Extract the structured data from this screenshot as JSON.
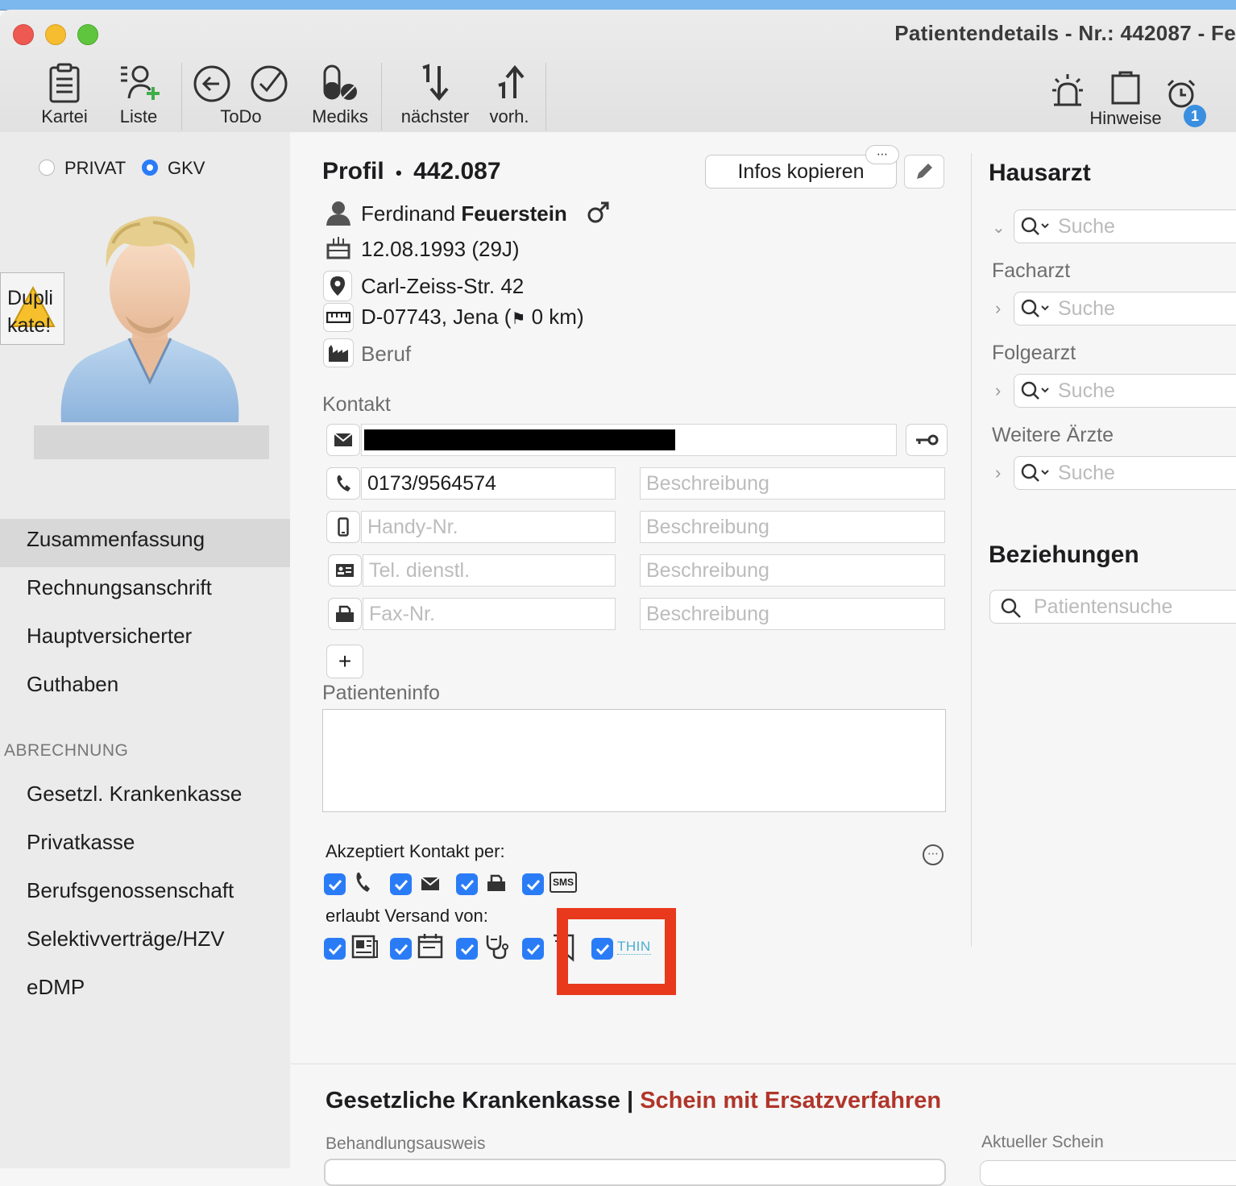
{
  "window": {
    "title": "Patientendetails - Nr.: 442087 - Fe"
  },
  "toolbar": {
    "kartei": "Kartei",
    "liste": "Liste",
    "todo": "ToDo",
    "mediks": "Mediks",
    "naechster": "nächster",
    "vorh": "vorh.",
    "hinweise": "Hinweise",
    "alarm_badge": "1"
  },
  "insurance": {
    "privat": "PRIVAT",
    "gkv": "GKV",
    "selected": "GKV"
  },
  "duplikate": {
    "line1": "Dupli",
    "line2": "kate!"
  },
  "nav": {
    "items": [
      "Zusammenfassung",
      "Rechnungsanschrift",
      "Hauptversicherter",
      "Guthaben"
    ],
    "section": "ABRECHNUNG",
    "billing": [
      "Gesetzl. Krankenkasse",
      "Privatkasse",
      "Berufsgenossenschaft",
      "Selektivverträge/HZV",
      "eDMP"
    ]
  },
  "profile": {
    "label": "Profil",
    "bullet": "•",
    "number": "442.087",
    "copy_button": "Infos kopieren",
    "first_name": "Ferdinand",
    "last_name": "Feuerstein",
    "birth": "12.08.1993 (29J)",
    "street": "Carl-Zeiss-Str. 42",
    "city_prefix": "D-07743, Jena (",
    "city_suffix": " 0 km)",
    "job": "Beruf"
  },
  "contact": {
    "label": "Kontakt",
    "phone": "0173/9564574",
    "mobile_placeholder": "Handy-Nr.",
    "work_placeholder": "Tel. dienstl.",
    "fax_placeholder": "Fax-Nr.",
    "desc_placeholder": "Beschreibung"
  },
  "patinfo": {
    "label": "Patienteninfo"
  },
  "accepts": {
    "label": "Akzeptiert Kontakt per:",
    "sms": "SMS"
  },
  "sending": {
    "label": "erlaubt Versand von:",
    "thin": "THIN"
  },
  "doctors": {
    "hausarzt": "Hausarzt",
    "facharzt": "Facharzt",
    "folgearzt": "Folgearzt",
    "weitere": "Weitere Ärzte",
    "search_placeholder": "Suche"
  },
  "relations": {
    "label": "Beziehungen",
    "search_placeholder": "Patientensuche"
  },
  "gkv_section": {
    "title": "Gesetzliche Krankenkasse",
    "separator": "|",
    "subtitle": "Schein mit Ersatzverfahren",
    "behandlungsausweis": "Behandlungsausweis",
    "aktueller_schein": "Aktueller Schein"
  },
  "colors": {
    "accent": "#2a7cf6",
    "highlight_box": "#e8391d",
    "subtitle_red": "#b0352a",
    "thin_teal": "#4aaed0"
  }
}
